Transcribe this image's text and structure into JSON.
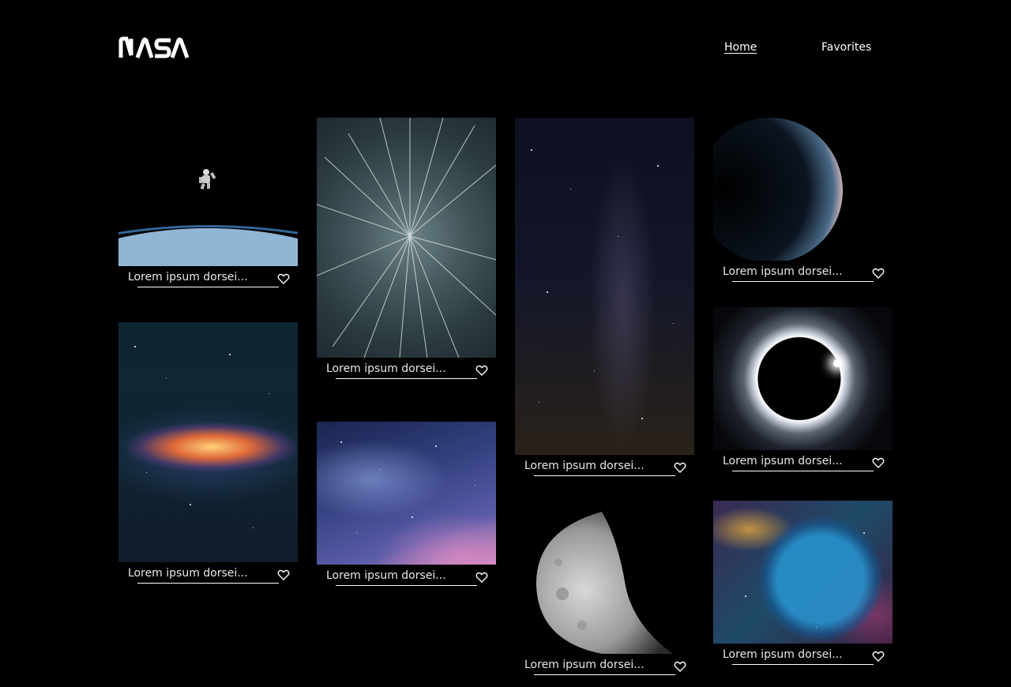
{
  "header": {
    "logo_text": "NASA",
    "nav": {
      "home": "Home",
      "favorites": "Favorites"
    }
  },
  "gallery": {
    "cards": [
      {
        "title": "Lorem ipsum dorsei...",
        "image": "astronaut-earth"
      },
      {
        "title": "Lorem ipsum dorsei...",
        "image": "galaxy-core"
      },
      {
        "title": "Lorem ipsum dorsei...",
        "image": "star-trails"
      },
      {
        "title": "Lorem ipsum dorsei...",
        "image": "blue-nebula"
      },
      {
        "title": "Lorem ipsum dorsei...",
        "image": "milky-way"
      },
      {
        "title": "Lorem ipsum dorsei...",
        "image": "moon"
      },
      {
        "title": "Lorem ipsum dorsei...",
        "image": "planet-crescent"
      },
      {
        "title": "Lorem ipsum dorsei...",
        "image": "solar-eclipse"
      },
      {
        "title": "Lorem ipsum dorsei...",
        "image": "bubble-nebula"
      }
    ],
    "favorite_icon": "heart-icon"
  },
  "colors": {
    "background": "#000000",
    "text": "#ffffff"
  }
}
